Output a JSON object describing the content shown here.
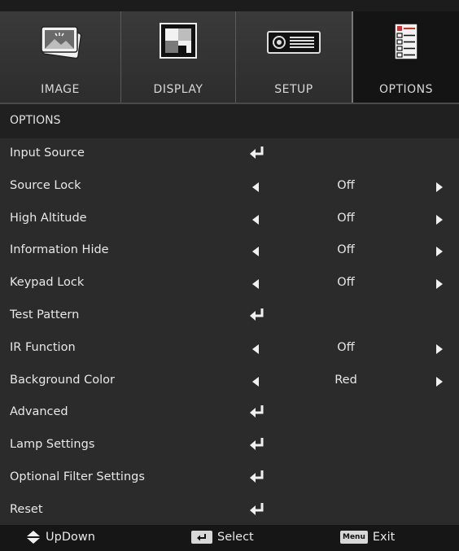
{
  "tabs": [
    {
      "label": "IMAGE",
      "icon": "picture-icon",
      "active": false
    },
    {
      "label": "DISPLAY",
      "icon": "display-pattern-icon",
      "active": false
    },
    {
      "label": "SETUP",
      "icon": "projector-icon",
      "active": false
    },
    {
      "label": "OPTIONS",
      "icon": "options-list-icon",
      "active": true
    }
  ],
  "section_title": "OPTIONS",
  "items": [
    {
      "label": "Input Source",
      "type": "enter"
    },
    {
      "label": "Source Lock",
      "type": "select",
      "value": "Off"
    },
    {
      "label": "High Altitude",
      "type": "select",
      "value": "Off"
    },
    {
      "label": "Information Hide",
      "type": "select",
      "value": "Off"
    },
    {
      "label": "Keypad Lock",
      "type": "select",
      "value": "Off"
    },
    {
      "label": "Test Pattern",
      "type": "enter"
    },
    {
      "label": "IR Function",
      "type": "select",
      "value": "Off"
    },
    {
      "label": "Background Color",
      "type": "select",
      "value": "Red"
    },
    {
      "label": "Advanced",
      "type": "enter"
    },
    {
      "label": "Lamp Settings",
      "type": "enter"
    },
    {
      "label": "Optional Filter Settings",
      "type": "enter"
    },
    {
      "label": "Reset",
      "type": "enter"
    }
  ],
  "footer": {
    "updown_label": "UpDown",
    "select_label": "Select",
    "exit_label": "Exit",
    "menu_key": "Menu"
  },
  "colors": {
    "background": "#2b2b2b",
    "active_tab": "#141414",
    "text": "#e8e8e8",
    "icon_accent_red": "#d0302a"
  }
}
